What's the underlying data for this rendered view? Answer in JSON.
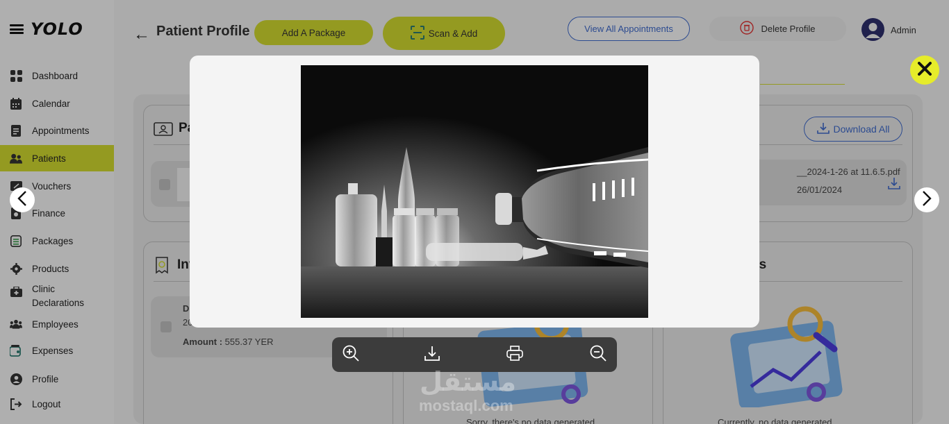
{
  "app": {
    "logo": "YOLO"
  },
  "sidebar": {
    "items": [
      {
        "label": "Dashboard",
        "icon": "dashboard-icon"
      },
      {
        "label": "Calendar",
        "icon": "calendar-icon"
      },
      {
        "label": "Appointments",
        "icon": "appointments-icon"
      },
      {
        "label": "Patients",
        "icon": "patients-icon",
        "active": true
      },
      {
        "label": "Vouchers",
        "icon": "vouchers-icon"
      },
      {
        "label": "Finance",
        "icon": "finance-icon"
      },
      {
        "label": "Packages",
        "icon": "packages-icon"
      },
      {
        "label": "Products",
        "icon": "products-icon"
      },
      {
        "label": "Clinic",
        "label2": "Declarations",
        "icon": "clinic-declarations-icon"
      },
      {
        "label": "Employees",
        "icon": "employees-icon"
      },
      {
        "label": "Expenses",
        "icon": "expenses-icon"
      },
      {
        "label": "Profile",
        "icon": "profile-icon"
      },
      {
        "label": "Logout",
        "icon": "logout-icon"
      }
    ]
  },
  "header": {
    "title": "Patient Profile",
    "add_package": "Add A Package",
    "scan_add": "Scan & Add",
    "view_appointments": "View All Appointments",
    "delete_profile": "Delete Profile",
    "user": "Admin"
  },
  "cards": {
    "personal_title_partial": "Pa",
    "invoices_title_partial": "Inv",
    "invoice": {
      "line1_partial": "D",
      "line2_partial": "20",
      "amount_label": "Amount :",
      "amount_value": "555.37 YER"
    },
    "files": {
      "download_all": "Download All",
      "file_name_partial": "__2024-1-26 at 11.6.5.pdf",
      "file_date": "26/01/2024"
    },
    "prescriptions_title_partial": "ns",
    "empty_text_1": "Sorry, there's no data generated",
    "empty_text_2": "Currently, no data generated"
  },
  "watermark": {
    "arabic": "مستقل",
    "latin": "mostaql.com"
  },
  "colors": {
    "accent": "#cdd62e",
    "blue": "#3d68c8",
    "close": "#e6ec2a"
  }
}
